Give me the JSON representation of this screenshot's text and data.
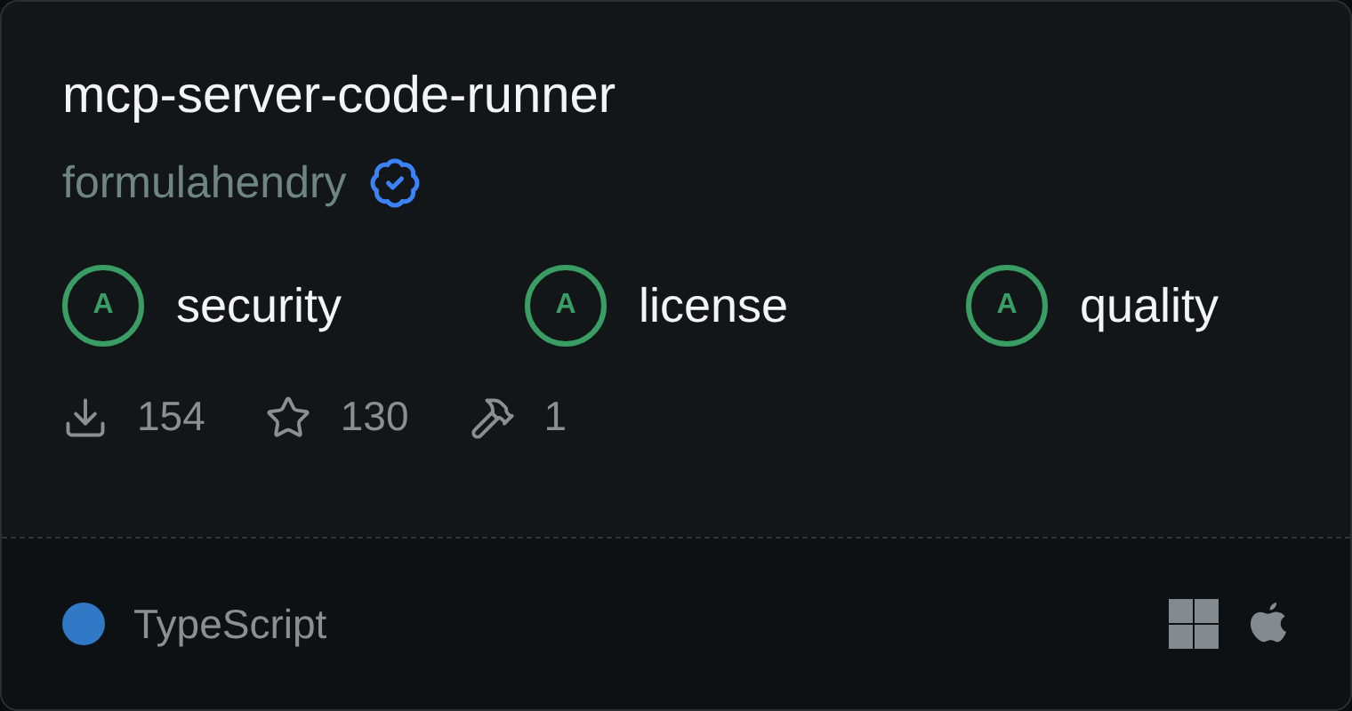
{
  "title": "mcp-server-code-runner",
  "author": {
    "name": "formulahendry",
    "verified": true
  },
  "grades": [
    {
      "grade": "A",
      "label": "security"
    },
    {
      "grade": "A",
      "label": "license"
    },
    {
      "grade": "A",
      "label": "quality"
    }
  ],
  "stats": [
    {
      "kind": "downloads",
      "value": "154"
    },
    {
      "kind": "stars",
      "value": "130"
    },
    {
      "kind": "tools",
      "value": "1"
    }
  ],
  "language": {
    "name": "TypeScript",
    "color": "#3178c6"
  },
  "platforms": [
    {
      "kind": "windows"
    },
    {
      "kind": "apple"
    }
  ]
}
